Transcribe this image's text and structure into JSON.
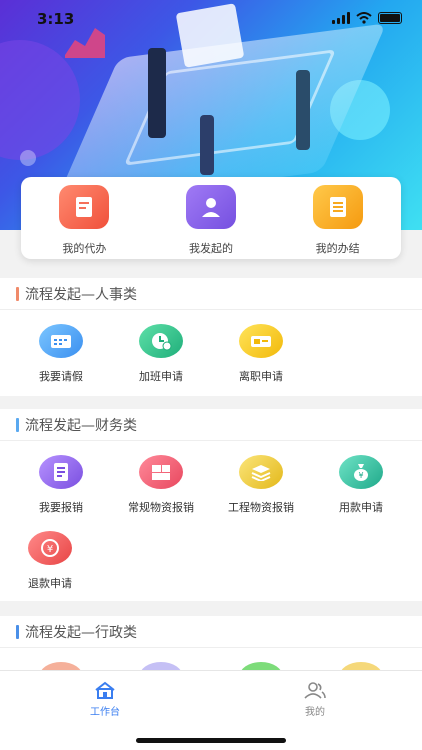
{
  "status": {
    "time": "3:13"
  },
  "quick": [
    {
      "label": "我的代办",
      "icon": "document-icon",
      "color": "#f5705a"
    },
    {
      "label": "我发起的",
      "icon": "user-icon",
      "color": "#8b63e6"
    },
    {
      "label": "我的办结",
      "icon": "list-icon",
      "color": "#f7a91f"
    }
  ],
  "sections": [
    {
      "title": "流程发起—人事类",
      "bar_color": "#f08a6a",
      "items": [
        {
          "label": "我要请假",
          "icon": "calendar-icon",
          "color": "#4aa3f5"
        },
        {
          "label": "加班申请",
          "icon": "clock-icon",
          "color": "#2cc08d"
        },
        {
          "label": "离职申请",
          "icon": "ticket-icon",
          "color": "#f2c515"
        }
      ]
    },
    {
      "title": "流程发起—财务类",
      "bar_color": "#5aa9f0",
      "items": [
        {
          "label": "我要报销",
          "icon": "receipt-icon",
          "color": "#9a6ee8"
        },
        {
          "label": "常规物资报销",
          "icon": "box-icon",
          "color": "#f06a7a"
        },
        {
          "label": "工程物资报销",
          "icon": "layers-icon",
          "color": "#e8c52a"
        },
        {
          "label": "用款申请",
          "icon": "money-bag-icon",
          "color": "#3cc4a8"
        },
        {
          "label": "退款申请",
          "icon": "refund-icon",
          "color": "#f06a6a"
        }
      ]
    },
    {
      "title": "流程发起—行政类",
      "bar_color": "#4a8fe8",
      "items": []
    }
  ],
  "tabs": [
    {
      "label": "工作台",
      "icon": "home-icon",
      "active": true
    },
    {
      "label": "我的",
      "icon": "users-icon",
      "active": false
    }
  ]
}
